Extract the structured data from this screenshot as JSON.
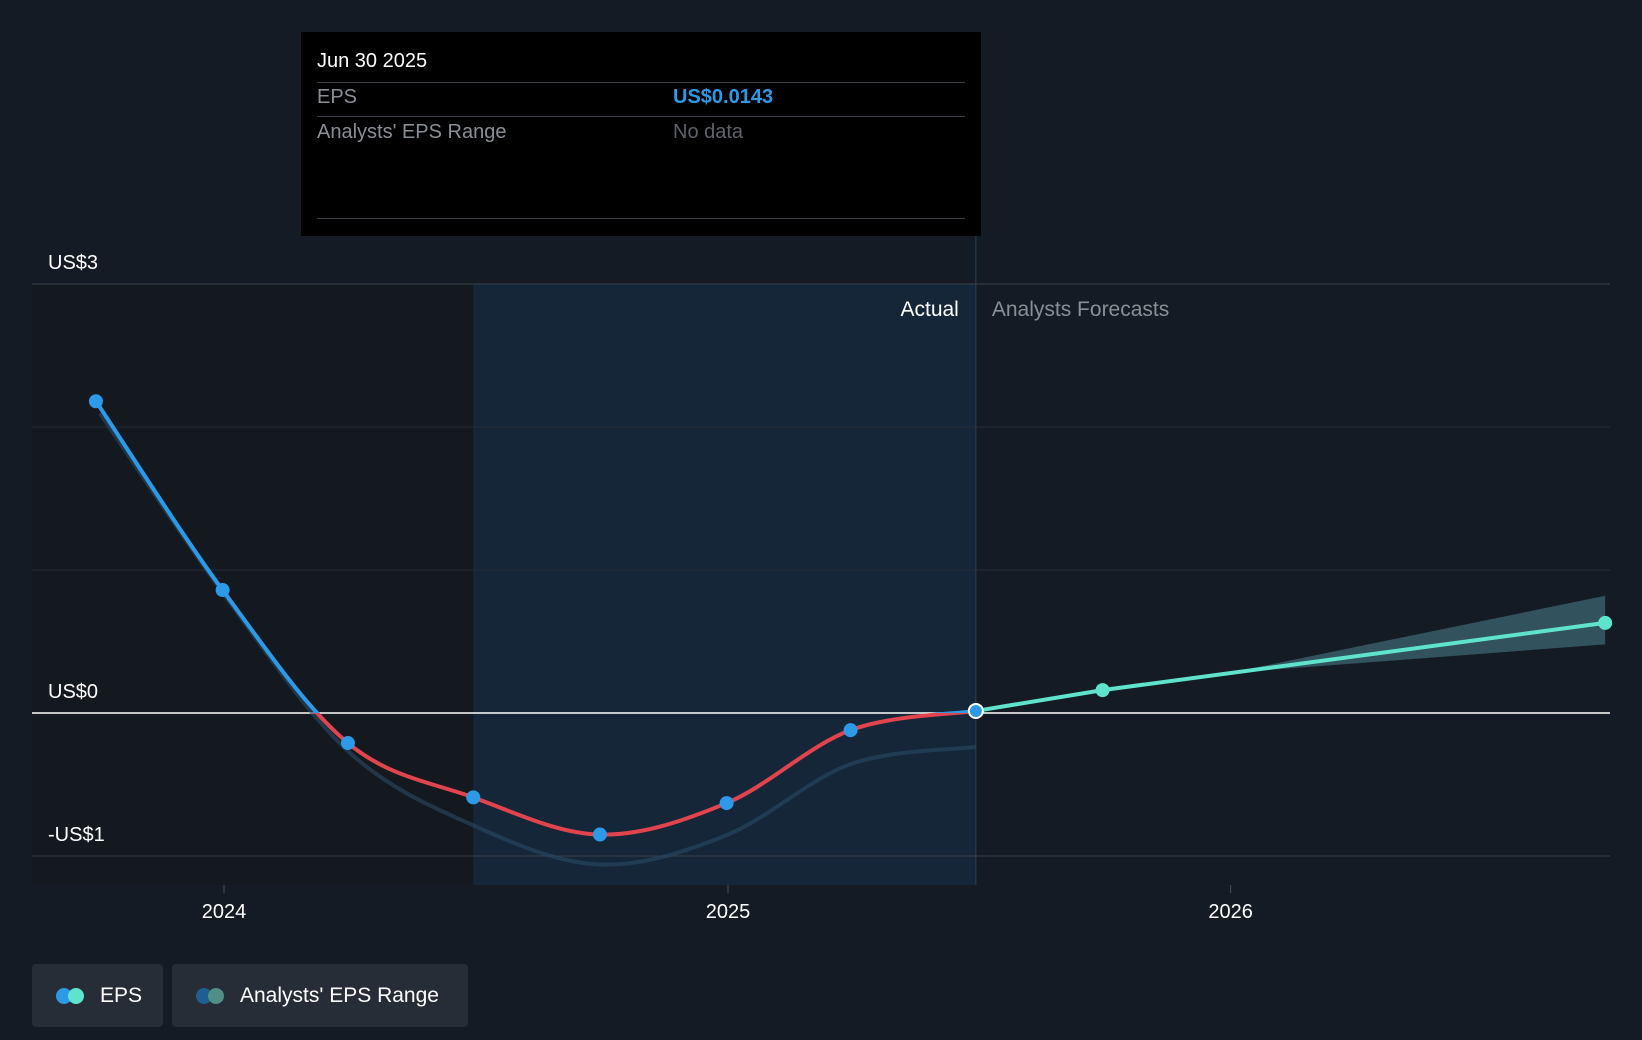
{
  "tooltip": {
    "date": "Jun 30 2025",
    "eps_label": "EPS",
    "eps_value": "US$0.0143",
    "range_label": "Analysts' EPS Range",
    "range_value": "No data"
  },
  "sections": {
    "actual_label": "Actual",
    "forecast_label": "Analysts Forecasts"
  },
  "legend": {
    "eps_label": "EPS",
    "range_label": "Analysts' EPS Range"
  },
  "colors": {
    "background": "#151b24",
    "eps_positive": "#2d9ae8",
    "eps_negative": "#e2444d",
    "forecast": "#5fe3cc",
    "range_band": "#3c6670",
    "actual_highlight": "#142638"
  },
  "chart_data": {
    "type": "line",
    "title": "",
    "xlabel": "",
    "ylabel": "",
    "y_ticks": [
      {
        "value": 3,
        "label": "US$3"
      },
      {
        "value": 0,
        "label": "US$0"
      },
      {
        "value": -1,
        "label": "-US$1"
      }
    ],
    "x_ticks": [
      {
        "value": "2024-01-01",
        "label": "2024"
      },
      {
        "value": "2025-01-01",
        "label": "2025"
      },
      {
        "value": "2026-01-01",
        "label": "2026"
      }
    ],
    "xlim": [
      "2023-09-01",
      "2026-09-30"
    ],
    "ylim": [
      -1,
      3
    ],
    "highlight_range": [
      "2024-06-30",
      "2025-06-30"
    ],
    "actual_forecast_divider": "2025-06-30",
    "grid": true,
    "legend_position": "bottom-left",
    "series": [
      {
        "name": "EPS",
        "kind": "actual",
        "points": [
          {
            "x": "2023-09-30",
            "y": 2.18
          },
          {
            "x": "2023-12-31",
            "y": 0.86
          },
          {
            "x": "2024-03-31",
            "y": -0.21
          },
          {
            "x": "2024-06-30",
            "y": -0.59
          },
          {
            "x": "2024-09-30",
            "y": -0.85
          },
          {
            "x": "2024-12-31",
            "y": -0.63
          },
          {
            "x": "2025-03-31",
            "y": -0.12
          },
          {
            "x": "2025-06-30",
            "y": 0.0143
          }
        ]
      },
      {
        "name": "EPS",
        "kind": "forecast",
        "points": [
          {
            "x": "2025-06-30",
            "y": 0.0143
          },
          {
            "x": "2025-09-30",
            "y": 0.16
          },
          {
            "x": "2026-09-30",
            "y": 0.63
          }
        ]
      },
      {
        "name": "Analysts' EPS Range",
        "kind": "range",
        "points": [
          {
            "x": "2025-12-31",
            "low": 0.28,
            "high": 0.28
          },
          {
            "x": "2026-09-30",
            "low": 0.48,
            "high": 0.82
          }
        ]
      }
    ]
  }
}
